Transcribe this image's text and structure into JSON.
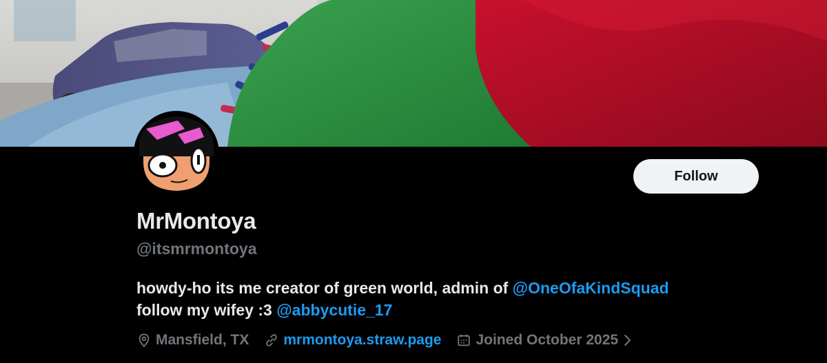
{
  "profile": {
    "display_name": "MrMontoya",
    "handle": "@itsmrmontoya",
    "follow_label": "Follow",
    "bio": {
      "line1_text": "howdy-ho its me creator of green world, admin of ",
      "line1_mention": "@OneOfaKindSquad",
      "line2_text": "follow my wifey :3 ",
      "line2_mention": "@abbycutie_17"
    },
    "location": "Mansfield, TX",
    "website": "mrmontoya.straw.page",
    "joined": "Joined October 2025"
  },
  "icons": {
    "location": "map-pin-icon",
    "website": "link-icon",
    "joined": "calendar-icon",
    "more": "chevron-right-icon"
  },
  "colors": {
    "background": "#000000",
    "text_primary": "#e7e9ea",
    "text_secondary": "#71767b",
    "accent_link": "#1d9bf0",
    "follow_button_bg": "#eff3f4"
  }
}
